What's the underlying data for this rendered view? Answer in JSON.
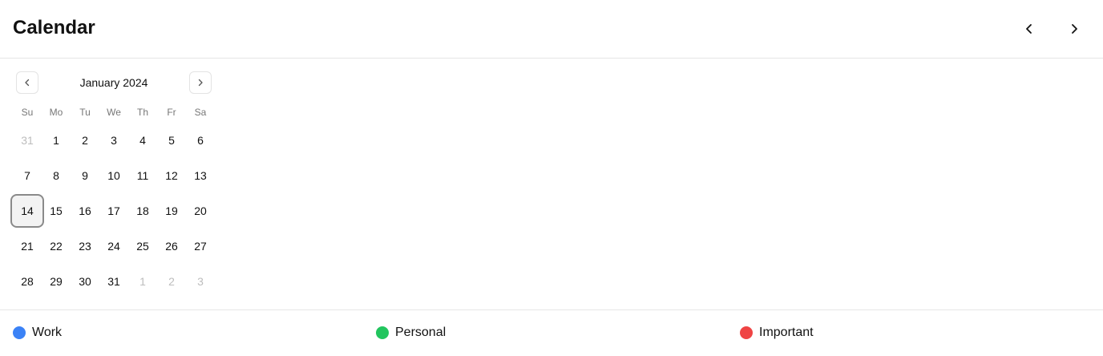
{
  "header": {
    "title": "Calendar",
    "prev_icon": "chevron-left-icon",
    "next_icon": "chevron-right-icon"
  },
  "calendar": {
    "month_label": "January 2024",
    "prev_icon": "chevron-left-icon",
    "next_icon": "chevron-right-icon",
    "weekdays": [
      "Su",
      "Mo",
      "Tu",
      "We",
      "Th",
      "Fr",
      "Sa"
    ],
    "selected_day": "14",
    "weeks": [
      [
        {
          "d": "31",
          "outside": true
        },
        {
          "d": "1"
        },
        {
          "d": "2"
        },
        {
          "d": "3"
        },
        {
          "d": "4"
        },
        {
          "d": "5"
        },
        {
          "d": "6"
        }
      ],
      [
        {
          "d": "7"
        },
        {
          "d": "8"
        },
        {
          "d": "9"
        },
        {
          "d": "10"
        },
        {
          "d": "11"
        },
        {
          "d": "12"
        },
        {
          "d": "13"
        }
      ],
      [
        {
          "d": "14",
          "selected": true
        },
        {
          "d": "15"
        },
        {
          "d": "16"
        },
        {
          "d": "17"
        },
        {
          "d": "18"
        },
        {
          "d": "19"
        },
        {
          "d": "20"
        }
      ],
      [
        {
          "d": "21"
        },
        {
          "d": "22"
        },
        {
          "d": "23"
        },
        {
          "d": "24"
        },
        {
          "d": "25"
        },
        {
          "d": "26"
        },
        {
          "d": "27"
        }
      ],
      [
        {
          "d": "28"
        },
        {
          "d": "29"
        },
        {
          "d": "30"
        },
        {
          "d": "31"
        },
        {
          "d": "1",
          "outside": true
        },
        {
          "d": "2",
          "outside": true
        },
        {
          "d": "3",
          "outside": true
        }
      ]
    ]
  },
  "legend": {
    "items": [
      {
        "label": "Work",
        "color": "#3b82f6"
      },
      {
        "label": "Personal",
        "color": "#22c55e"
      },
      {
        "label": "Important",
        "color": "#ef4444"
      }
    ]
  }
}
